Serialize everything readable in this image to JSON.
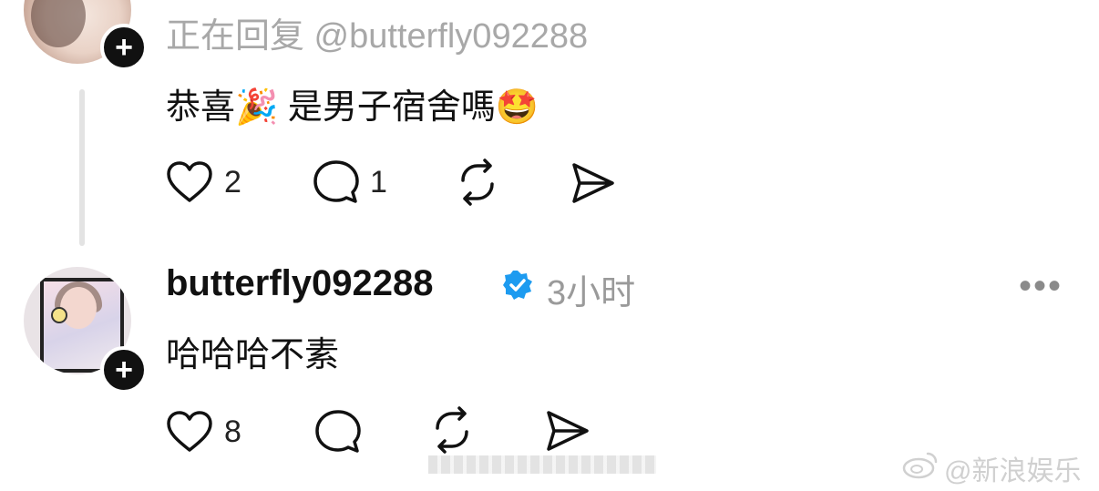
{
  "reply_post": {
    "replying_to": "正在回复 @butterfly092288",
    "text": "恭喜🎉 是男子宿舍嗎🤩",
    "like_count": "2",
    "comment_count": "1"
  },
  "comment_post": {
    "username": "butterfly092288",
    "time": "3小时",
    "text": "哈哈哈不素",
    "like_count": "8"
  },
  "more_label": "•••",
  "follow_badge": "+",
  "watermark": "@新浪娱乐",
  "colors": {
    "verified": "#1d9bf0",
    "muted_text": "#a8a8a8",
    "thread_line": "#e3e3e3"
  }
}
